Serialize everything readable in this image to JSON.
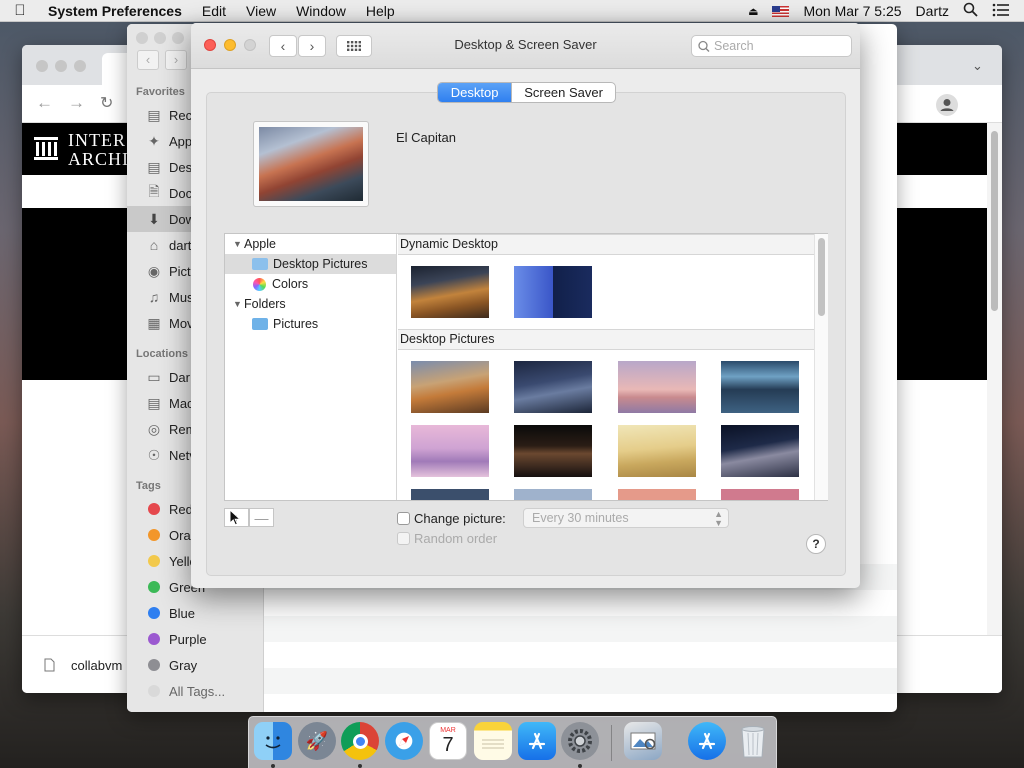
{
  "menubar": {
    "app_name": "System Preferences",
    "items": [
      "Edit",
      "View",
      "Window",
      "Help"
    ],
    "clock": "Mon Mar 7  5:25",
    "user": "Dartz"
  },
  "browser": {
    "ia_logo_line1": "INTER",
    "ia_logo_line2": "ARCHIV",
    "download_file": "collabvm"
  },
  "finder": {
    "favorites_header": "Favorites",
    "favorites": [
      "Rec",
      "App",
      "Des",
      "Doc",
      "Dow",
      "dart",
      "Pict",
      "Mus",
      "Mov"
    ],
    "locations_header": "Locations",
    "locations": [
      "Dar",
      "Mac",
      "Rem",
      "Netv"
    ],
    "tags_header": "Tags",
    "tags": [
      {
        "label": "Red",
        "color": "#e5484d"
      },
      {
        "label": "Ora",
        "color": "#f2962a"
      },
      {
        "label": "Yello",
        "color": "#f2c94c"
      },
      {
        "label": "Green",
        "color": "#3cb957"
      },
      {
        "label": "Blue",
        "color": "#2f7ff0"
      },
      {
        "label": "Purple",
        "color": "#9b59d0"
      },
      {
        "label": "Gray",
        "color": "#8e8e93"
      },
      {
        "label": "All Tags...",
        "color": "#d9d9d9"
      }
    ]
  },
  "prefs": {
    "title": "Desktop & Screen Saver",
    "search_placeholder": "Search",
    "tabs": [
      "Desktop",
      "Screen Saver"
    ],
    "current_wallpaper": "El Capitan",
    "tree": {
      "apple": "Apple",
      "desktop_pictures": "Desktop Pictures",
      "colors": "Colors",
      "folders": "Folders",
      "pictures": "Pictures"
    },
    "sections": [
      "Dynamic Desktop",
      "Desktop Pictures"
    ],
    "change_picture_label": "Change picture:",
    "interval": "Every 30 minutes",
    "random_order_label": "Random order",
    "help": "?",
    "add": "+",
    "remove": "—"
  },
  "dock": {
    "calendar_month": "MAR",
    "calendar_day": "7"
  }
}
